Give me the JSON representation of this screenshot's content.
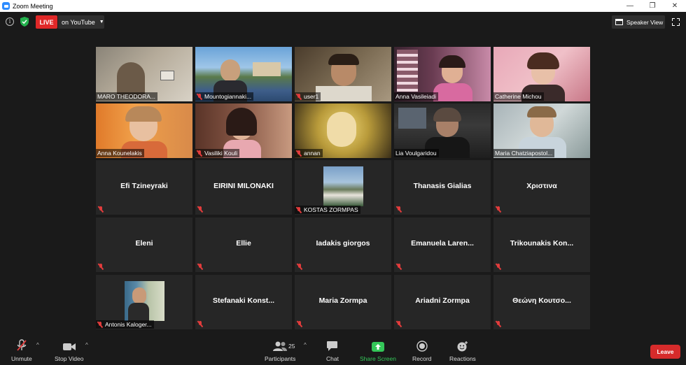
{
  "window": {
    "title": "Zoom Meeting",
    "controls": [
      "—",
      "❐",
      "✕"
    ]
  },
  "topbar": {
    "live_label": "LIVE",
    "stream_target": "on YouTube",
    "view_label": "Speaker View"
  },
  "video_tiles": [
    {
      "name": "MARO THEODORA...",
      "muted": false
    },
    {
      "name": "Mountogiannaki...",
      "muted": true
    },
    {
      "name": "user1",
      "muted": true
    },
    {
      "name": "Anna Vasileiadi",
      "muted": false
    },
    {
      "name": "Catherine Michou",
      "muted": false
    },
    {
      "name": "Anna Kounelakis",
      "muted": false
    },
    {
      "name": "Vasiliki Kouli",
      "muted": true
    },
    {
      "name": "annan",
      "muted": true
    },
    {
      "name": "Lia Voulgaridou",
      "muted": false
    },
    {
      "name": "Maria Chatziapostol...",
      "muted": false
    }
  ],
  "name_tiles": [
    {
      "name": "Efi Tzineyraki"
    },
    {
      "name": "EIRINI MILONAKI"
    },
    {
      "name": "KOSTAS ZORMPAS",
      "has_image": true
    },
    {
      "name": "Thanasis Gialias"
    },
    {
      "name": "Χριστινα"
    },
    {
      "name": "Eleni"
    },
    {
      "name": "Ellie"
    },
    {
      "name": "Iadakis giorgos"
    },
    {
      "name": "Emanuela  Laren..."
    },
    {
      "name": "Trikounakis  Kon..."
    },
    {
      "name": "Antonis Kaloger...",
      "has_image": true
    },
    {
      "name": "Stefanaki  Konst..."
    },
    {
      "name": "Maria Zormpa"
    },
    {
      "name": "Ariadni Zormpa"
    },
    {
      "name": "Θεώνη  Κουτσο..."
    }
  ],
  "toolbar": {
    "unmute": "Unmute",
    "stop_video": "Stop Video",
    "participants": "Participants",
    "participant_count": "25",
    "chat": "Chat",
    "share_screen": "Share Screen",
    "record": "Record",
    "reactions": "Reactions",
    "leave": "Leave"
  },
  "colors": {
    "live": "#e02828",
    "leave": "#d62b2b",
    "share": "#34c759",
    "active_speaker": "#d7e36a",
    "muted_mic": "#e23c3c"
  }
}
